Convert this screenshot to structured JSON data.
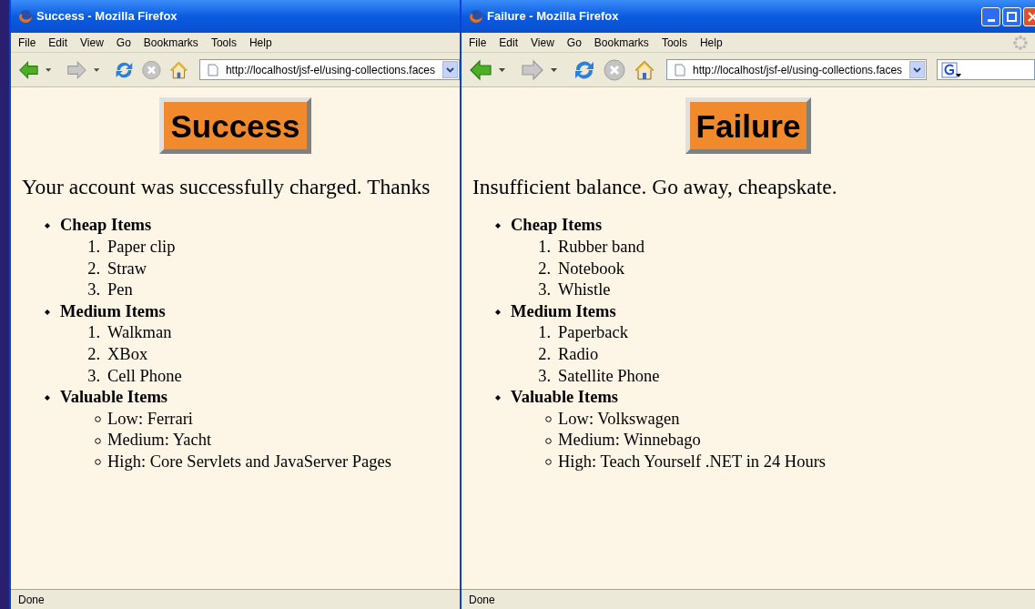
{
  "windows": [
    {
      "title": "Success - Mozilla Firefox",
      "window_controls": false,
      "search_box": false,
      "throbber": false,
      "menu": [
        "File",
        "Edit",
        "View",
        "Go",
        "Bookmarks",
        "Tools",
        "Help"
      ],
      "url": "http://localhost/jsf-el/using-collections.faces",
      "heading": "Success",
      "message": "Your account was successfully charged. Thanks",
      "groups": [
        {
          "title": "Cheap Items",
          "kind": "numbered",
          "items": [
            {
              "number": "1.",
              "text": "Paper clip"
            },
            {
              "number": "2.",
              "text": "Straw"
            },
            {
              "number": "3.",
              "text": "Pen"
            }
          ]
        },
        {
          "title": "Medium Items",
          "kind": "numbered",
          "items": [
            {
              "number": "1.",
              "text": "Walkman"
            },
            {
              "number": "2.",
              "text": "XBox"
            },
            {
              "number": "3.",
              "text": "Cell Phone"
            }
          ]
        },
        {
          "title": "Valuable Items",
          "kind": "circles",
          "items": [
            {
              "text": "Low: Ferrari"
            },
            {
              "text": "Medium: Yacht"
            },
            {
              "text": "High: Core Servlets and JavaServer Pages"
            }
          ]
        }
      ],
      "status": "Done"
    },
    {
      "title": "Failure - Mozilla Firefox",
      "window_controls": true,
      "search_box": true,
      "throbber": true,
      "menu": [
        "File",
        "Edit",
        "View",
        "Go",
        "Bookmarks",
        "Tools",
        "Help"
      ],
      "url": "http://localhost/jsf-el/using-collections.faces",
      "heading": "Failure",
      "message": "Insufficient balance. Go away, cheapskate.",
      "groups": [
        {
          "title": "Cheap Items",
          "kind": "numbered",
          "items": [
            {
              "number": "1.",
              "text": "Rubber band"
            },
            {
              "number": "2.",
              "text": "Notebook"
            },
            {
              "number": "3.",
              "text": "Whistle"
            }
          ]
        },
        {
          "title": "Medium Items",
          "kind": "numbered",
          "items": [
            {
              "number": "1.",
              "text": "Paperback"
            },
            {
              "number": "2.",
              "text": "Radio"
            },
            {
              "number": "3.",
              "text": "Satellite Phone"
            }
          ]
        },
        {
          "title": "Valuable Items",
          "kind": "circles",
          "items": [
            {
              "text": "Low: Volkswagen"
            },
            {
              "text": "Medium: Winnebago"
            },
            {
              "text": "High: Teach Yourself .NET in 24 Hours"
            }
          ]
        }
      ],
      "status": "Done"
    }
  ]
}
